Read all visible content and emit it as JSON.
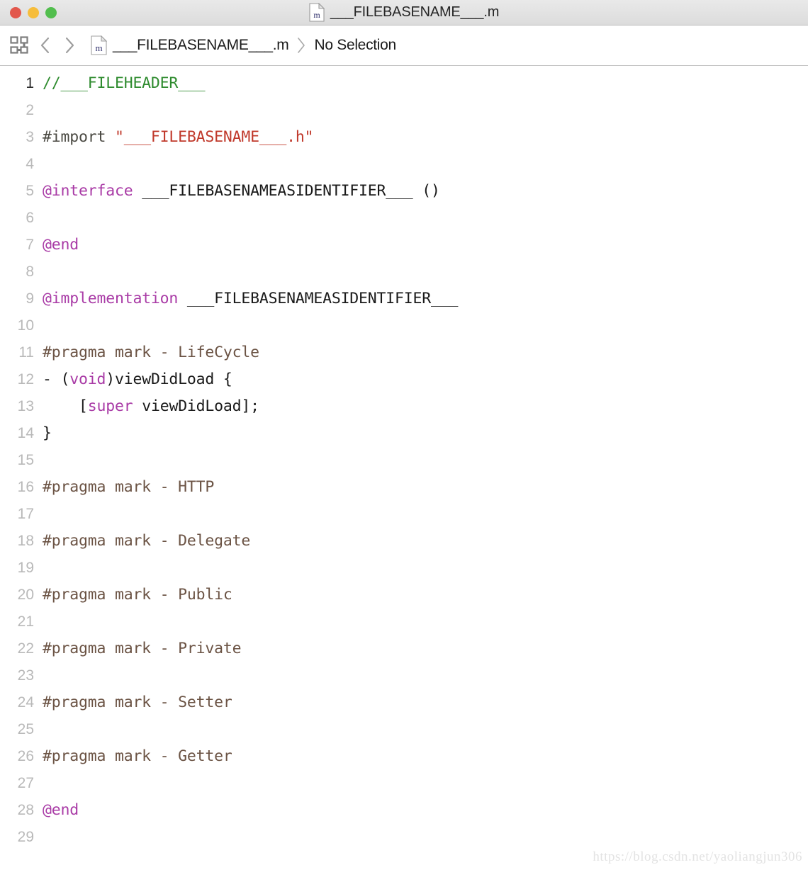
{
  "window": {
    "title": "___FILEBASENAME___.m",
    "title_icon": "objective-c-file-icon",
    "traffic_lights": {
      "close_label": "Close",
      "minimize_label": "Minimize",
      "maximize_label": "Maximize",
      "close_color": "#e2574c",
      "minimize_color": "#f6bd3b",
      "maximize_color": "#52be4e"
    }
  },
  "jumpbar": {
    "related_items_icon": "related-items-grid-icon",
    "back_icon": "chevron-left-icon",
    "forward_icon": "chevron-right-icon",
    "file_icon": "objective-c-file-icon",
    "file_letter": "m",
    "file_name": "___FILEBASENAME___.m",
    "separator_icon": "chevron-right-separator-icon",
    "selection": "No Selection"
  },
  "editor": {
    "current_line": 1,
    "colors": {
      "comment": "#2e8b2e",
      "preprocessor": "#4b4a43",
      "string": "#c0392b",
      "keyword": "#a93ba6",
      "pragma": "#6b5344",
      "plain": "#1a1a1a",
      "gutter": "#b9b9b9",
      "background": "#ffffff"
    },
    "lines": [
      {
        "n": "1",
        "tokens": [
          {
            "t": "comment",
            "s": "//___FILEHEADER___"
          }
        ]
      },
      {
        "n": "2",
        "tokens": []
      },
      {
        "n": "3",
        "tokens": [
          {
            "t": "pre",
            "s": "#import "
          },
          {
            "t": "string",
            "s": "\"___FILEBASENAME___.h\""
          }
        ]
      },
      {
        "n": "4",
        "tokens": []
      },
      {
        "n": "5",
        "tokens": [
          {
            "t": "keyword",
            "s": "@interface"
          },
          {
            "t": "plain",
            "s": " ___FILEBASENAMEASIDENTIFIER___ ()"
          }
        ]
      },
      {
        "n": "6",
        "tokens": []
      },
      {
        "n": "7",
        "tokens": [
          {
            "t": "keyword",
            "s": "@end"
          }
        ]
      },
      {
        "n": "8",
        "tokens": []
      },
      {
        "n": "9",
        "tokens": [
          {
            "t": "keyword",
            "s": "@implementation"
          },
          {
            "t": "plain",
            "s": " ___FILEBASENAMEASIDENTIFIER___"
          }
        ]
      },
      {
        "n": "10",
        "tokens": []
      },
      {
        "n": "11",
        "tokens": [
          {
            "t": "pragma",
            "s": "#pragma mark - LifeCycle"
          }
        ]
      },
      {
        "n": "12",
        "tokens": [
          {
            "t": "plain",
            "s": "- ("
          },
          {
            "t": "keyword",
            "s": "void"
          },
          {
            "t": "plain",
            "s": ")viewDidLoad {"
          }
        ]
      },
      {
        "n": "13",
        "tokens": [
          {
            "t": "plain",
            "s": "    ["
          },
          {
            "t": "keyword",
            "s": "super"
          },
          {
            "t": "plain",
            "s": " viewDidLoad];"
          }
        ]
      },
      {
        "n": "14",
        "tokens": [
          {
            "t": "plain",
            "s": "}"
          }
        ]
      },
      {
        "n": "15",
        "tokens": []
      },
      {
        "n": "16",
        "tokens": [
          {
            "t": "pragma",
            "s": "#pragma mark - HTTP"
          }
        ]
      },
      {
        "n": "17",
        "tokens": []
      },
      {
        "n": "18",
        "tokens": [
          {
            "t": "pragma",
            "s": "#pragma mark - Delegate"
          }
        ]
      },
      {
        "n": "19",
        "tokens": []
      },
      {
        "n": "20",
        "tokens": [
          {
            "t": "pragma",
            "s": "#pragma mark - Public"
          }
        ]
      },
      {
        "n": "21",
        "tokens": []
      },
      {
        "n": "22",
        "tokens": [
          {
            "t": "pragma",
            "s": "#pragma mark - Private"
          }
        ]
      },
      {
        "n": "23",
        "tokens": []
      },
      {
        "n": "24",
        "tokens": [
          {
            "t": "pragma",
            "s": "#pragma mark - Setter"
          }
        ]
      },
      {
        "n": "25",
        "tokens": []
      },
      {
        "n": "26",
        "tokens": [
          {
            "t": "pragma",
            "s": "#pragma mark - Getter"
          }
        ]
      },
      {
        "n": "27",
        "tokens": []
      },
      {
        "n": "28",
        "tokens": [
          {
            "t": "keyword",
            "s": "@end"
          }
        ]
      },
      {
        "n": "29",
        "tokens": []
      }
    ]
  },
  "watermark": {
    "text": "https://blog.csdn.net/yaoliangjun306"
  }
}
